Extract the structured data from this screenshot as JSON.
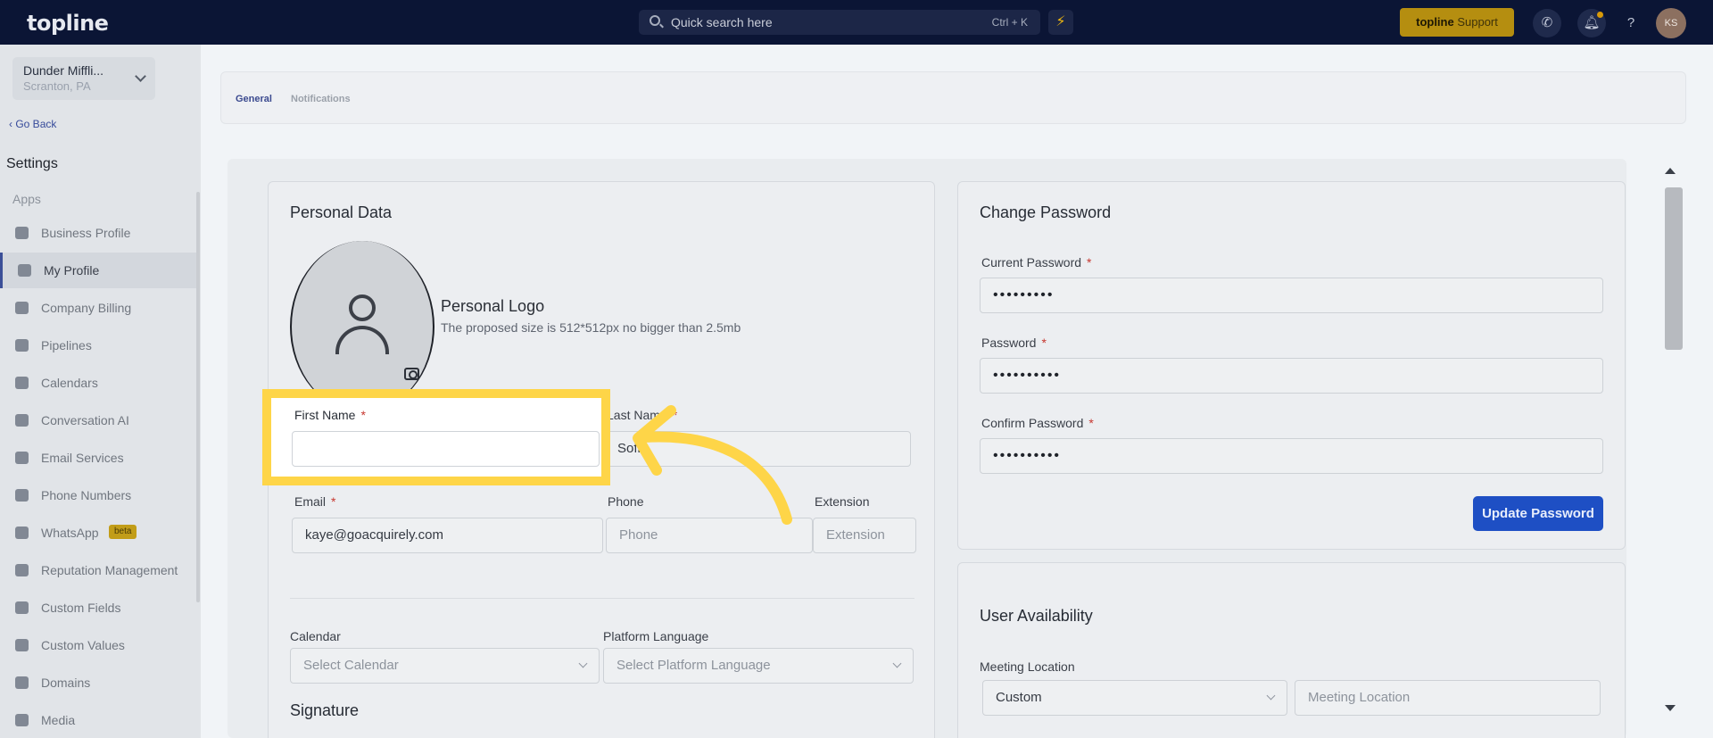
{
  "topbar": {
    "logo": "topline",
    "search_placeholder": "Quick search here",
    "search_shortcut": "Ctrl + K",
    "support_brand": "topline",
    "support_label": "Support",
    "user_initials": "KS"
  },
  "sidebar": {
    "location_name": "Dunder Miffli...",
    "location_sub": "Scranton, PA",
    "go_back": "Go Back",
    "title": "Settings",
    "section_label": "Apps",
    "items": [
      {
        "label": "Business Profile",
        "icon": "briefcase-icon"
      },
      {
        "label": "My Profile",
        "icon": "user-icon"
      },
      {
        "label": "Company Billing",
        "icon": "grid-icon"
      },
      {
        "label": "Pipelines",
        "icon": "filter-icon"
      },
      {
        "label": "Calendars",
        "icon": "calendar-icon"
      },
      {
        "label": "Conversation AI",
        "icon": "chat-icon"
      },
      {
        "label": "Email Services",
        "icon": "mail-icon"
      },
      {
        "label": "Phone Numbers",
        "icon": "phone-icon"
      },
      {
        "label": "WhatsApp",
        "icon": "whatsapp-icon",
        "badge": "beta"
      },
      {
        "label": "Reputation Management",
        "icon": "star-icon"
      },
      {
        "label": "Custom Fields",
        "icon": "edit-icon"
      },
      {
        "label": "Custom Values",
        "icon": "pie-icon"
      },
      {
        "label": "Domains",
        "icon": "server-icon"
      },
      {
        "label": "Media",
        "icon": "video-icon"
      }
    ],
    "active_item": "My Profile"
  },
  "tabs": [
    {
      "label": "General",
      "active": true
    },
    {
      "label": "Notifications",
      "active": false
    }
  ],
  "personal": {
    "title": "Personal Data",
    "logo_title": "Personal Logo",
    "logo_hint": "The proposed size is 512*512px no bigger than 2.5mb",
    "first_name_label": "First Name",
    "first_name_value": "",
    "last_name_label": "Last Name",
    "last_name_value": "Sofia",
    "email_label": "Email",
    "email_value": "kaye@goacquirely.com",
    "phone_label": "Phone",
    "phone_placeholder": "Phone",
    "extension_label": "Extension",
    "extension_placeholder": "Extension",
    "calendar_label": "Calendar",
    "calendar_placeholder": "Select Calendar",
    "language_label": "Platform Language",
    "language_placeholder": "Select Platform Language",
    "signature_title": "Signature",
    "required_mark": "*"
  },
  "password": {
    "title": "Change Password",
    "current_label": "Current Password",
    "current_value": "•••••••••",
    "new_label": "Password",
    "new_value": "••••••••••",
    "confirm_label": "Confirm Password",
    "confirm_value": "••••••••••",
    "update_button": "Update Password"
  },
  "availability": {
    "title": "User Availability",
    "meeting_location_label": "Meeting Location",
    "meeting_type_value": "Custom",
    "meeting_location_placeholder": "Meeting Location"
  },
  "colors": {
    "topbar": "#0b1535",
    "accent": "#1e4fc4",
    "highlight": "#fed548",
    "support": "#b58e10"
  }
}
